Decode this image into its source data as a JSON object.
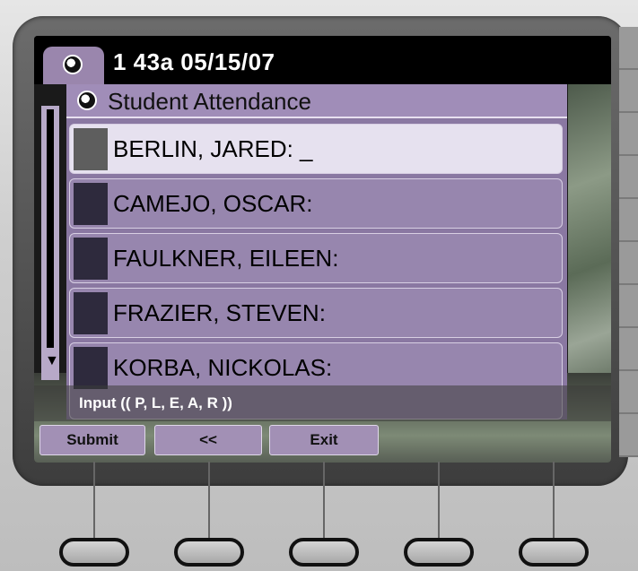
{
  "status": {
    "title": "1 43a 05/15/07"
  },
  "service": {
    "header": "Student Attendance"
  },
  "students": [
    {
      "label": "BERLIN, JARED: _",
      "selected": true
    },
    {
      "label": "CAMEJO, OSCAR:",
      "selected": false
    },
    {
      "label": "FAULKNER, EILEEN:",
      "selected": false
    },
    {
      "label": "FRAZIER, STEVEN:",
      "selected": false
    },
    {
      "label": "KORBA, NICKOLAS:",
      "selected": false
    }
  ],
  "prompt": {
    "text": "Input (( P, L, E, A, R ))"
  },
  "softkeys": {
    "submit": "Submit",
    "back": "<<",
    "exit": "Exit"
  },
  "icons": {
    "status_icon": "globe-icon",
    "header_icon": "globe-icon",
    "scroll_down": "arrow-down-icon"
  },
  "colors": {
    "panel": "#8a78a2",
    "selected_row": "#e6e1ef",
    "titlebar": "#000000"
  }
}
